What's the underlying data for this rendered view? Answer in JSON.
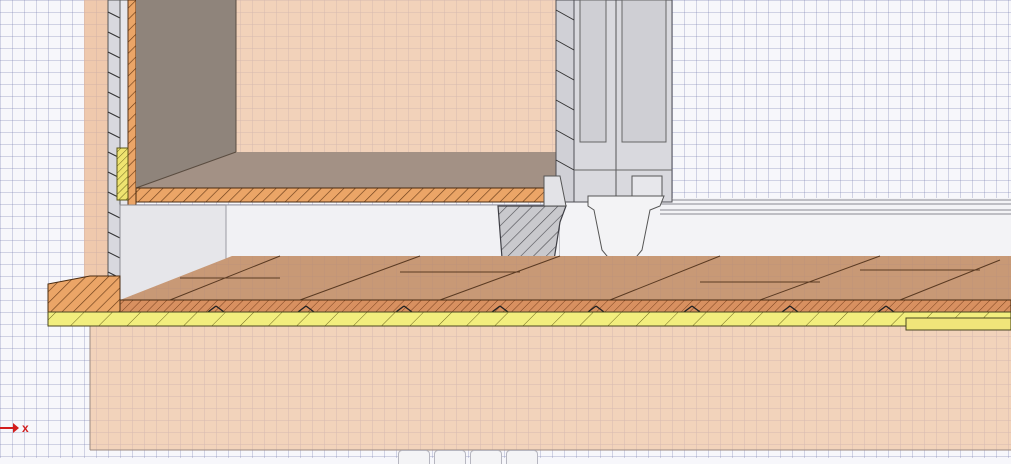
{
  "axis": {
    "x_label": "x",
    "color": "#d21d1d"
  },
  "toolbar": {
    "buttons": [
      {
        "id": "view-button-1"
      },
      {
        "id": "view-button-2"
      },
      {
        "id": "view-button-3"
      },
      {
        "id": "view-button-4"
      }
    ]
  },
  "colors": {
    "grid_background": "#f7f7fb",
    "wall_fill": "#f6d7bf",
    "floor_wood": "#c08a62",
    "floor_section": "#e8a36b",
    "subfloor_yellow": "#f0ec7a",
    "cabinet_white": "#e9e9ee",
    "foot_grey": "#cfcfd3",
    "outline": "#4a4540"
  }
}
